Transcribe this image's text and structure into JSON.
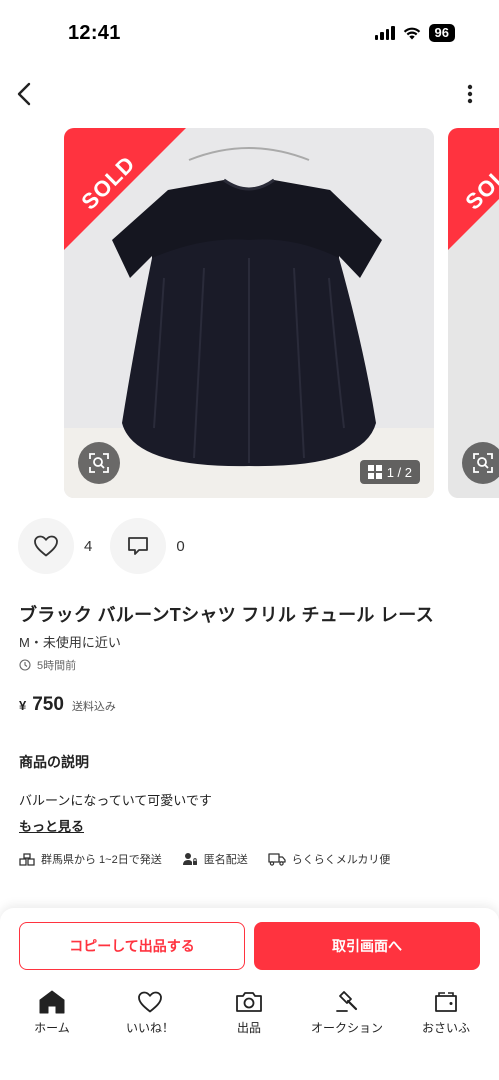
{
  "status": {
    "time": "12:41",
    "battery": "96"
  },
  "product": {
    "sold_label": "SOLD",
    "image_counter": "1 / 2",
    "likes": "4",
    "comments": "0",
    "title": "ブラック バルーンTシャツ フリル チュール レース",
    "condition": "M・未使用に近い",
    "posted": "5時間前",
    "price_symbol": "¥",
    "price": "750",
    "price_note": "送料込み"
  },
  "description": {
    "heading": "商品の説明",
    "text": "バルーンになっていて可愛いです",
    "more_link": "もっと見る"
  },
  "shipping": {
    "from": "群馬県から 1~2日で発送",
    "anonymous": "匿名配送",
    "method": "らくらくメルカリ便"
  },
  "buttons": {
    "copy": "コピーして出品する",
    "trade": "取引画面へ"
  },
  "tabs": [
    {
      "label": "ホーム",
      "icon": "home-icon"
    },
    {
      "label": "いいね！",
      "icon": "heart-icon"
    },
    {
      "label": "出品",
      "icon": "camera-icon"
    },
    {
      "label": "オークション",
      "icon": "gavel-icon"
    },
    {
      "label": "おさいふ",
      "icon": "wallet-icon"
    }
  ],
  "colors": {
    "accent": "#ff333f",
    "text": "#222222"
  }
}
